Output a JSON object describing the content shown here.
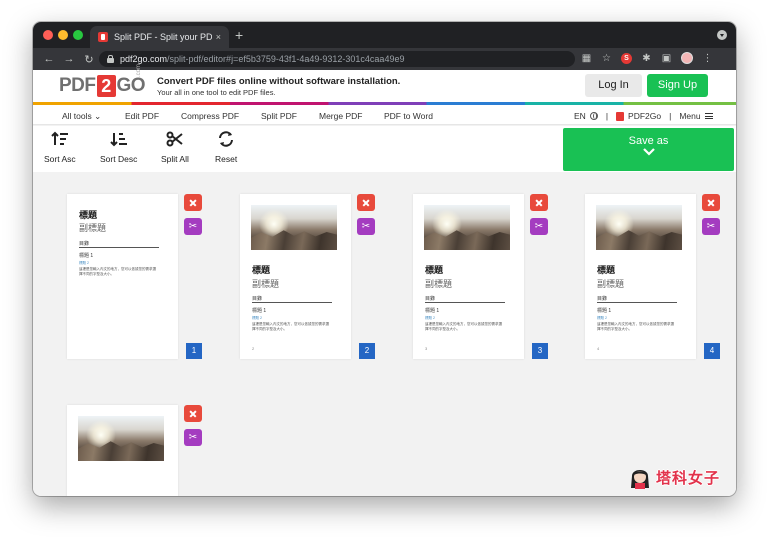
{
  "browser": {
    "tab_title": "Split PDF - Split your PDF docu",
    "tab_close": "×",
    "new_tab": "+",
    "url_host": "pdf2go.com",
    "url_path": "/split-pdf/editor#j=ef5b3759-43f1-4a49-9312-301c4caa49e9",
    "ext_badge": "S"
  },
  "header": {
    "logo_left": "PDF",
    "logo_mid": "2",
    "logo_right": "GO",
    "logo_com": ".com",
    "headline": "Convert PDF files online without software installation.",
    "subline": "Your all in one tool to edit PDF files.",
    "login": "Log In",
    "signup": "Sign Up"
  },
  "nav": {
    "items": [
      "All tools",
      "Edit PDF",
      "Compress PDF",
      "Split PDF",
      "Merge PDF",
      "PDF to Word"
    ],
    "lang": "EN",
    "brand": "PDF2Go",
    "menu": "Menu",
    "sep": "|"
  },
  "toolbar": {
    "sort_asc": "Sort Asc",
    "sort_desc": "Sort Desc",
    "split_all": "Split All",
    "reset": "Reset",
    "save_as": "Save as"
  },
  "pages": [
    {
      "number": "1",
      "title": "標題",
      "subtitle": "副標題",
      "toc": "目錄",
      "heading": "標題 1",
      "small": "標題 2",
      "text": "這裡是您輸入內文的地方，您可以依據您的需求選擇不同的字型及大小。",
      "footer": ""
    },
    {
      "number": "2",
      "title": "標題",
      "subtitle": "副標題",
      "toc": "目錄",
      "heading": "標題 1",
      "small": "標題 2",
      "text": "這裡是您輸入內文的地方，您可以依據您的需求選擇不同的字型及大小。",
      "footer": "2"
    },
    {
      "number": "3",
      "title": "標題",
      "subtitle": "副標題",
      "toc": "目錄",
      "heading": "標題 1",
      "small": "標題 2",
      "text": "這裡是您輸入內文的地方，您可以依據您的需求選擇不同的字型及大小。",
      "footer": "3"
    },
    {
      "number": "4",
      "title": "標題",
      "subtitle": "副標題",
      "toc": "目錄",
      "heading": "標題 1",
      "small": "標題 2",
      "text": "這裡是您輸入內文的地方，您可以依據您的需求選擇不同的字型及大小。",
      "footer": "4"
    }
  ],
  "watermark": "塔科女子",
  "colors": {
    "accent_green": "#19c154",
    "delete_red": "#e84a3c",
    "split_purple": "#a43cc0",
    "badge_blue": "#2466c4"
  }
}
